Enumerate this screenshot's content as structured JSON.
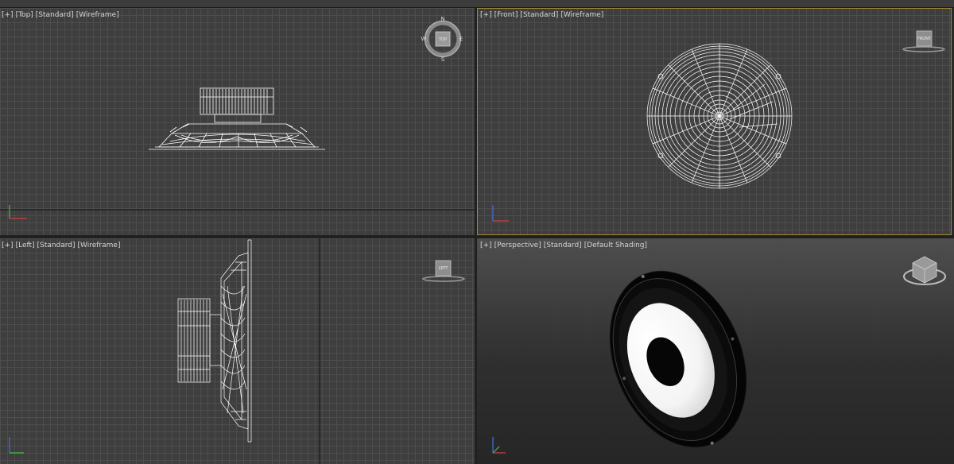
{
  "viewports": {
    "top": {
      "menu": "[+]",
      "view": "[Top]",
      "shading_mode": "[Standard]",
      "display": "[Wireframe]"
    },
    "front": {
      "menu": "[+]",
      "view": "[Front]",
      "shading_mode": "[Standard]",
      "display": "[Wireframe]"
    },
    "left": {
      "menu": "[+]",
      "view": "[Left]",
      "shading_mode": "[Standard]",
      "display": "[Wireframe]"
    },
    "perspective": {
      "menu": "[+]",
      "view": "[Perspective]",
      "shading_mode": "[Standard]",
      "display": "[Default Shading]"
    }
  },
  "viewcube": {
    "top_face": "TOP",
    "front_face": "FRONT",
    "left_face": "LEFT",
    "compass": {
      "north": "N",
      "south": "S",
      "east": "E",
      "west": "W"
    }
  },
  "colors": {
    "active_border": "#a2892e",
    "grid": "#4d4d4d",
    "wire": "#ffffff",
    "axis_x": "#d04040",
    "axis_y": "#40c040",
    "axis_z": "#4070e0"
  }
}
